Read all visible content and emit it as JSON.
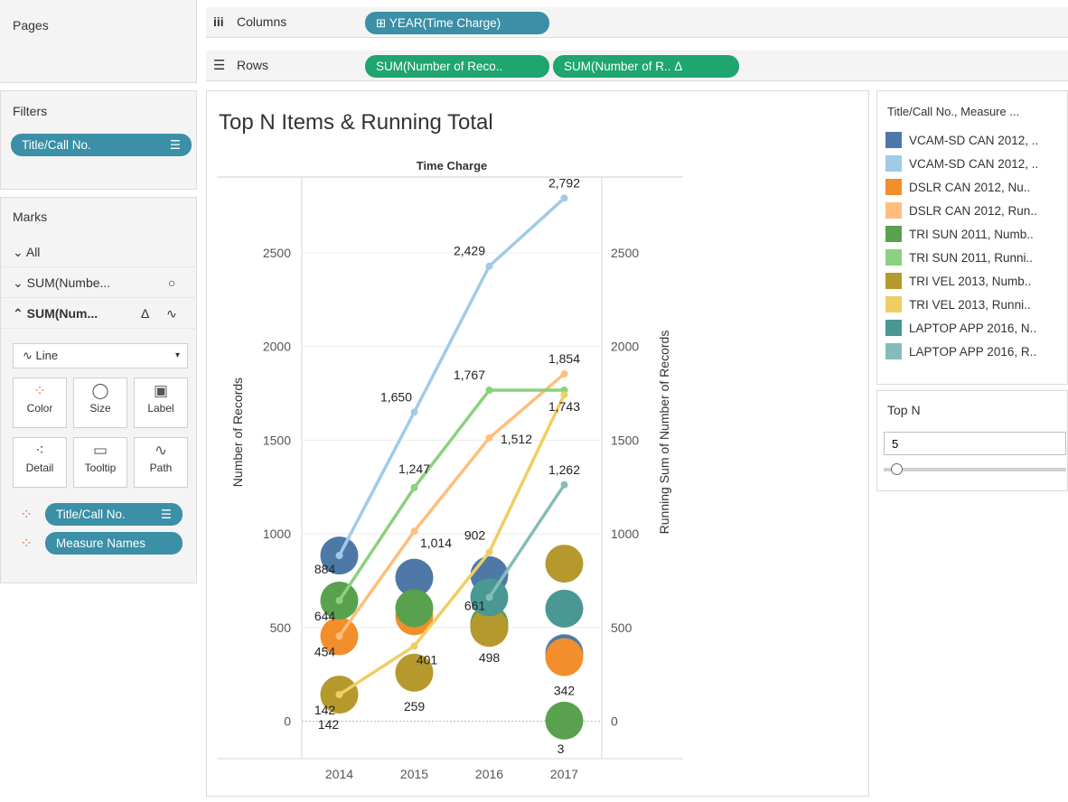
{
  "pages_label": "Pages",
  "columns": {
    "label": "Columns",
    "pill": "⊞ YEAR(Time Charge)"
  },
  "rows": {
    "label": "Rows",
    "pill1": "SUM(Number of Reco..",
    "pill2": "SUM(Number of R..  Δ"
  },
  "filters": {
    "label": "Filters",
    "pill": "Title/Call No."
  },
  "marks": {
    "label": "Marks",
    "all": "All",
    "sum1": "SUM(Numbe...",
    "sum2": "SUM(Num...",
    "mark_type": "Line",
    "buttons": [
      "Color",
      "Size",
      "Label",
      "Detail",
      "Tooltip",
      "Path"
    ],
    "pill1": "Title/Call No.",
    "pill2": "Measure Names"
  },
  "legend": {
    "title": "Title/Call No., Measure ...",
    "items": [
      {
        "label": "VCAM-SD CAN 2012, ..",
        "color": "#4e79a7"
      },
      {
        "label": "VCAM-SD CAN 2012, ..",
        "color": "#a0cbe8"
      },
      {
        "label": "DSLR CAN 2012, Nu..",
        "color": "#f28e2b"
      },
      {
        "label": "DSLR CAN 2012, Run..",
        "color": "#ffbe7d"
      },
      {
        "label": "TRI SUN 2011, Numb..",
        "color": "#59a14f"
      },
      {
        "label": "TRI SUN 2011, Runni..",
        "color": "#8cd17d"
      },
      {
        "label": "TRI VEL 2013, Numb..",
        "color": "#b6992d"
      },
      {
        "label": "TRI VEL 2013, Runni..",
        "color": "#f1ce63"
      },
      {
        "label": "LAPTOP APP 2016, N..",
        "color": "#499894"
      },
      {
        "label": "LAPTOP APP 2016, R..",
        "color": "#86bcb6"
      }
    ]
  },
  "topn": {
    "title": "Top N",
    "value": "5"
  },
  "chart_data": {
    "type": "line",
    "title": "Top N Items & Running Total",
    "header": "Time Charge",
    "categories": [
      "2014",
      "2015",
      "2016",
      "2017"
    ],
    "ylabel_left": "Number of Records",
    "ylabel_right": "Running Sum of Number of Records",
    "ylim": [
      -200,
      2900
    ],
    "yticks": [
      0,
      500,
      1000,
      1500,
      2000,
      2500
    ],
    "ytick_labels": [
      "0",
      "500",
      "1000",
      "1500",
      "2000",
      "2500"
    ],
    "circles": [
      {
        "series": "VCAM-SD CAN 2012",
        "color": "#4e79a7",
        "values": [
          884,
          766,
          779,
          363
        ]
      },
      {
        "series": "DSLR CAN 2012",
        "color": "#f28e2b",
        "values": [
          454,
          560,
          498,
          342
        ]
      },
      {
        "series": "TRI SUN 2011",
        "color": "#59a14f",
        "values": [
          644,
          603,
          520,
          3
        ]
      },
      {
        "series": "TRI VEL 2013",
        "color": "#b6992d",
        "values": [
          142,
          259,
          500,
          841
        ]
      },
      {
        "series": "LAPTOP APP 2016",
        "color": "#499894",
        "values": [
          null,
          null,
          661,
          601
        ]
      }
    ],
    "lines": [
      {
        "series": "VCAM-SD CAN 2012",
        "color": "#a0cbe8",
        "values": [
          884,
          1650,
          2429,
          2792
        ]
      },
      {
        "series": "DSLR CAN 2012",
        "color": "#ffbe7d",
        "values": [
          454,
          1014,
          1512,
          1854
        ]
      },
      {
        "series": "TRI SUN 2011",
        "color": "#8cd17d",
        "values": [
          644,
          1247,
          1767,
          1767
        ]
      },
      {
        "series": "TRI VEL 2013",
        "color": "#f1ce63",
        "values": [
          142,
          401,
          902,
          1743
        ]
      },
      {
        "series": "LAPTOP APP 2016",
        "color": "#86bcb6",
        "values": [
          null,
          null,
          661,
          1262
        ]
      }
    ],
    "labels": [
      {
        "text": "2,792",
        "cat": 3,
        "value": 2792,
        "dx": 0,
        "dy": -12
      },
      {
        "text": "2,429",
        "cat": 2,
        "value": 2429,
        "dx": -22,
        "dy": -12
      },
      {
        "text": "1,650",
        "cat": 1,
        "value": 1650,
        "dx": -20,
        "dy": -12
      },
      {
        "text": "1,767",
        "cat": 2,
        "value": 1767,
        "dx": -22,
        "dy": -12
      },
      {
        "text": "1,854",
        "cat": 3,
        "value": 1854,
        "dx": 0,
        "dy": -12
      },
      {
        "text": "1,743",
        "cat": 3,
        "value": 1743,
        "dx": 0,
        "dy": 18
      },
      {
        "text": "1,512",
        "cat": 2,
        "value": 1512,
        "dx": 30,
        "dy": 6
      },
      {
        "text": "1,247",
        "cat": 1,
        "value": 1247,
        "dx": 0,
        "dy": -16
      },
      {
        "text": "1,262",
        "cat": 3,
        "value": 1262,
        "dx": 0,
        "dy": -12
      },
      {
        "text": "1,014",
        "cat": 1,
        "value": 1014,
        "dx": 24,
        "dy": 18
      },
      {
        "text": "902",
        "cat": 2,
        "value": 902,
        "dx": -16,
        "dy": -14
      },
      {
        "text": "884",
        "cat": 0,
        "value": 884,
        "dx": -16,
        "dy": 20
      },
      {
        "text": "644",
        "cat": 0,
        "value": 644,
        "dx": -16,
        "dy": 22
      },
      {
        "text": "661",
        "cat": 2,
        "value": 661,
        "dx": -16,
        "dy": 14
      },
      {
        "text": "454",
        "cat": 0,
        "value": 454,
        "dx": -16,
        "dy": 22
      },
      {
        "text": "401",
        "cat": 1,
        "value": 401,
        "dx": 14,
        "dy": 20
      },
      {
        "text": "498",
        "cat": 2,
        "value": 498,
        "dx": 0,
        "dy": 38
      },
      {
        "text": "342",
        "cat": 3,
        "value": 342,
        "dx": 0,
        "dy": 42
      },
      {
        "text": "259",
        "cat": 1,
        "value": 259,
        "dx": 0,
        "dy": 42
      },
      {
        "text": "142",
        "cat": 0,
        "value": 142,
        "dx": -16,
        "dy": 22
      },
      {
        "text": "142",
        "cat": 0,
        "value": 142,
        "dx": -12,
        "dy": 38
      },
      {
        "text": "3",
        "cat": 3,
        "value": 3,
        "dx": -4,
        "dy": 36
      }
    ]
  }
}
